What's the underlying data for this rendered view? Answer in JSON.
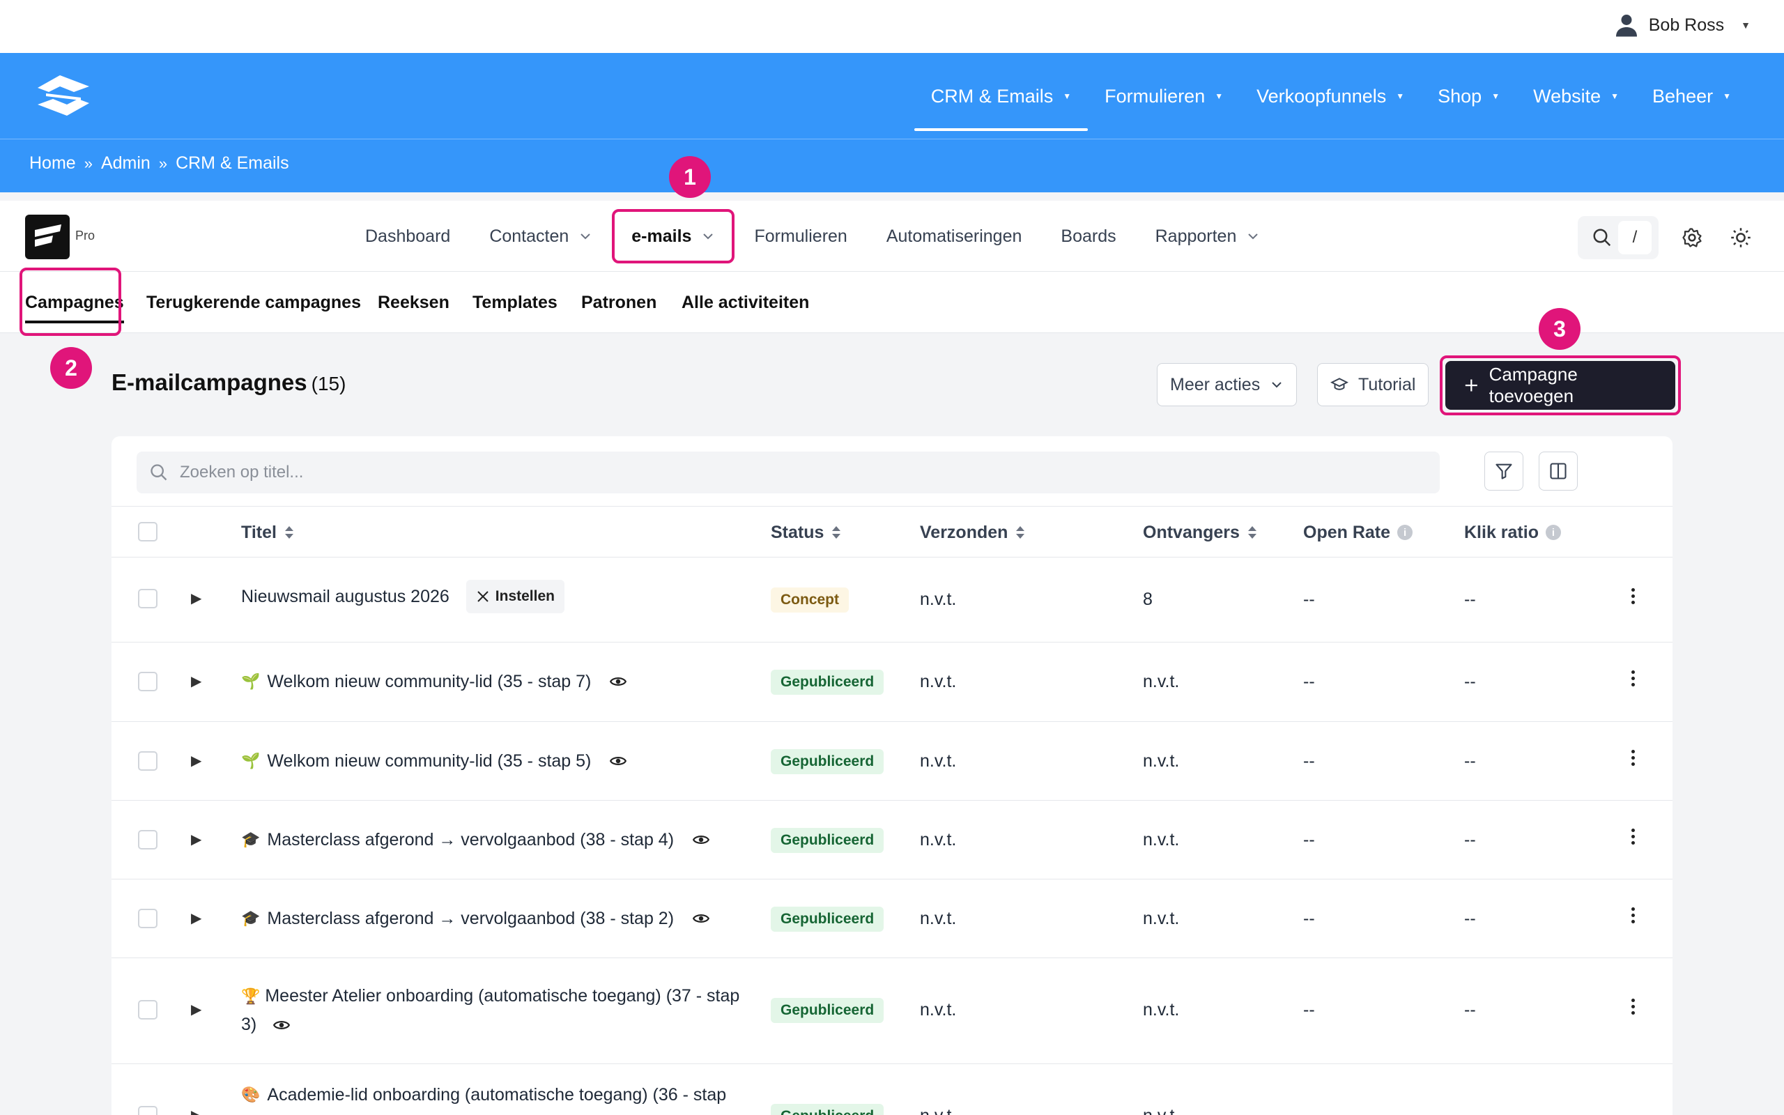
{
  "user": {
    "name": "Bob Ross"
  },
  "main_nav": [
    {
      "label": "CRM & Emails",
      "active": true
    },
    {
      "label": "Formulieren"
    },
    {
      "label": "Verkoopfunnels"
    },
    {
      "label": "Shop"
    },
    {
      "label": "Website"
    },
    {
      "label": "Beheer"
    }
  ],
  "breadcrumb": {
    "home": "Home",
    "sep": "»",
    "admin": "Admin",
    "current": "CRM & Emails"
  },
  "app": {
    "badge": "Pro",
    "search_shortcut": "/"
  },
  "app_nav": [
    "Dashboard",
    "Contacten",
    "e-mails",
    "Formulieren",
    "Automatiseringen",
    "Boards",
    "Rapporten"
  ],
  "sub_tabs": [
    "Campagnes",
    "Terugkerende campagnes",
    "Reeksen",
    "Templates",
    "Patronen",
    "Alle activiteiten"
  ],
  "markers": [
    "1",
    "2",
    "3"
  ],
  "page": {
    "title": "E-mailcampagnes",
    "count": "(15)",
    "more_actions": "Meer acties",
    "tutorial": "Tutorial",
    "add_campaign": "Campagne toevoegen",
    "search_placeholder": "Zoeken op titel..."
  },
  "table": {
    "columns": [
      "Titel",
      "Status",
      "Verzonden",
      "Ontvangers",
      "Open Rate",
      "Klik ratio"
    ],
    "setup_label": "Instellen",
    "rows": [
      {
        "emoji": "",
        "title": "Nieuwsmail augustus 2026",
        "status": "Concept",
        "sent": "n.v.t.",
        "recipients": "8",
        "open_rate": "--",
        "click_rate": "--"
      },
      {
        "emoji": "🌱",
        "title": "Welkom nieuw community-lid (35 - stap 7)",
        "status": "Gepubliceerd",
        "sent": "n.v.t.",
        "recipients": "n.v.t.",
        "open_rate": "--",
        "click_rate": "--"
      },
      {
        "emoji": "🌱",
        "title": "Welkom nieuw community-lid (35 - stap 5)",
        "status": "Gepubliceerd",
        "sent": "n.v.t.",
        "recipients": "n.v.t.",
        "open_rate": "--",
        "click_rate": "--"
      },
      {
        "emoji": "🎓",
        "title": "Masterclass afgerond → vervolgaanbod (38 - stap 4)",
        "status": "Gepubliceerd",
        "sent": "n.v.t.",
        "recipients": "n.v.t.",
        "open_rate": "--",
        "click_rate": "--"
      },
      {
        "emoji": "🎓",
        "title": "Masterclass afgerond → vervolgaanbod (38 - stap 2)",
        "status": "Gepubliceerd",
        "sent": "n.v.t.",
        "recipients": "n.v.t.",
        "open_rate": "--",
        "click_rate": "--"
      },
      {
        "emoji": "🏆",
        "title": "Meester Atelier onboarding (automatische toegang) (37 - stap 3)",
        "status": "Gepubliceerd",
        "sent": "n.v.t.",
        "recipients": "n.v.t.",
        "open_rate": "--",
        "click_rate": "--"
      },
      {
        "emoji": "🎨",
        "title": "Academie-lid onboarding (automatische toegang) (36 - stap",
        "status": "Gepubliceerd",
        "sent": "n.v.t.",
        "recipients": "n.v.t.",
        "open_rate": "--",
        "click_rate": "--"
      }
    ]
  },
  "colors": {
    "brand_blue": "#3596fa",
    "highlight": "#e0157a",
    "primary_button": "#1d1d2b",
    "published_bg": "#e3f6e8",
    "concept_bg": "#fdf6e4"
  }
}
